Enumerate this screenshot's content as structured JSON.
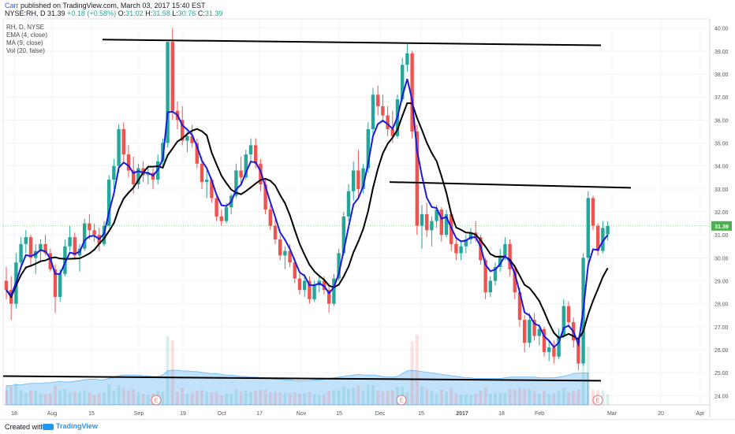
{
  "header": {
    "author": "Carr",
    "published_text": "published on TradingView.com, March 03, 2017 15:40 EST",
    "symbol": "NYSE:RH, D",
    "last": "31.39",
    "change": "+0.18 (+0.58%)",
    "open_label": "O:",
    "open": "31.02",
    "high_label": "H:",
    "high": "31.58",
    "low_label": "L:",
    "low": "30.76",
    "close_label": "C:",
    "close": "31.39"
  },
  "legend": {
    "lines": [
      "RH, D, NYSE",
      "EMA (4, close)",
      "MA (9, close)",
      "Vol (20, false)"
    ]
  },
  "footer": {
    "created_with": "Created with",
    "brand": "TradingView"
  },
  "colors": {
    "up": "#26a69a",
    "down": "#ef5350",
    "ema": "#1a1adb",
    "ma": "#000000",
    "volume_ma": "#90caf9",
    "price_badge": "#4caf50",
    "earnings": "#e57373"
  },
  "chart_data": {
    "type": "candlestick",
    "symbol": "RH, D, NYSE",
    "ylim": [
      23.6,
      40.4
    ],
    "y_ticks": [
      "24.00",
      "25.00",
      "26.00",
      "27.00",
      "28.00",
      "29.00",
      "30.00",
      "31.00",
      "32.00",
      "33.00",
      "34.00",
      "35.00",
      "36.00",
      "37.00",
      "38.00",
      "39.00",
      "40.00"
    ],
    "x_ticks": [
      "18",
      "Aug",
      "15",
      "Sep",
      "19",
      "Oct",
      "17",
      "Nov",
      "15",
      "Dec",
      "15",
      "2017",
      "18",
      "Feb",
      "Mar",
      "20",
      "Apr"
    ],
    "last_price_label": "31.39",
    "earnings_marker": "E",
    "trend_lines": [
      {
        "from": [
          "2016-08-31",
          39.5
        ],
        "to": [
          "2017-03-03",
          39.25
        ]
      },
      {
        "from": [
          "2016-12-05",
          33.3
        ],
        "to": [
          "2017-03-10",
          33.05
        ]
      },
      {
        "from": [
          "2016-07-15",
          24.85
        ],
        "to": [
          "2017-03-03",
          24.65
        ]
      }
    ],
    "candles": [
      {
        "o": 29.0,
        "h": 29.6,
        "l": 28.2,
        "c": 28.6
      },
      {
        "o": 28.6,
        "h": 29.2,
        "l": 27.3,
        "c": 28.0
      },
      {
        "o": 28.0,
        "h": 30.2,
        "l": 27.8,
        "c": 29.8
      },
      {
        "o": 29.8,
        "h": 30.9,
        "l": 29.5,
        "c": 30.6
      },
      {
        "o": 30.6,
        "h": 31.2,
        "l": 30.2,
        "c": 30.9
      },
      {
        "o": 30.9,
        "h": 31.0,
        "l": 29.6,
        "c": 30.0
      },
      {
        "o": 30.0,
        "h": 30.6,
        "l": 29.3,
        "c": 30.3
      },
      {
        "o": 30.3,
        "h": 30.8,
        "l": 29.8,
        "c": 30.6
      },
      {
        "o": 30.6,
        "h": 31.0,
        "l": 30.1,
        "c": 30.2
      },
      {
        "o": 30.2,
        "h": 30.4,
        "l": 29.4,
        "c": 29.5
      },
      {
        "o": 29.5,
        "h": 29.7,
        "l": 27.6,
        "c": 28.3
      },
      {
        "o": 28.3,
        "h": 29.5,
        "l": 28.1,
        "c": 29.3
      },
      {
        "o": 29.3,
        "h": 30.8,
        "l": 29.2,
        "c": 30.5
      },
      {
        "o": 30.5,
        "h": 31.4,
        "l": 30.3,
        "c": 30.9
      },
      {
        "o": 30.9,
        "h": 31.1,
        "l": 29.9,
        "c": 30.1
      },
      {
        "o": 30.1,
        "h": 30.6,
        "l": 29.4,
        "c": 30.4
      },
      {
        "o": 30.4,
        "h": 31.7,
        "l": 30.3,
        "c": 31.5
      },
      {
        "o": 31.5,
        "h": 31.9,
        "l": 30.8,
        "c": 31.2
      },
      {
        "o": 31.2,
        "h": 31.5,
        "l": 30.7,
        "c": 31.0
      },
      {
        "o": 31.0,
        "h": 31.3,
        "l": 30.3,
        "c": 30.6
      },
      {
        "o": 30.6,
        "h": 31.6,
        "l": 30.5,
        "c": 31.4
      },
      {
        "o": 31.4,
        "h": 33.6,
        "l": 31.3,
        "c": 33.4
      },
      {
        "o": 33.4,
        "h": 34.3,
        "l": 33.0,
        "c": 34.0
      },
      {
        "o": 34.0,
        "h": 35.8,
        "l": 33.7,
        "c": 35.6
      },
      {
        "o": 35.6,
        "h": 35.9,
        "l": 34.2,
        "c": 34.5
      },
      {
        "o": 34.5,
        "h": 34.9,
        "l": 33.5,
        "c": 33.8
      },
      {
        "o": 33.8,
        "h": 34.4,
        "l": 32.8,
        "c": 33.2
      },
      {
        "o": 33.2,
        "h": 34.1,
        "l": 33.0,
        "c": 33.9
      },
      {
        "o": 33.9,
        "h": 34.2,
        "l": 33.3,
        "c": 33.6
      },
      {
        "o": 33.6,
        "h": 34.0,
        "l": 33.2,
        "c": 33.7
      },
      {
        "o": 33.7,
        "h": 33.9,
        "l": 33.0,
        "c": 33.4
      },
      {
        "o": 33.4,
        "h": 34.5,
        "l": 33.2,
        "c": 34.2
      },
      {
        "o": 34.2,
        "h": 35.2,
        "l": 34.0,
        "c": 35.0
      },
      {
        "o": 35.0,
        "h": 39.4,
        "l": 34.8,
        "c": 39.4
      },
      {
        "o": 39.4,
        "h": 40.0,
        "l": 36.0,
        "c": 36.4
      },
      {
        "o": 36.4,
        "h": 36.8,
        "l": 35.6,
        "c": 36.0
      },
      {
        "o": 36.0,
        "h": 36.6,
        "l": 34.9,
        "c": 35.1
      },
      {
        "o": 35.1,
        "h": 35.5,
        "l": 34.6,
        "c": 35.3
      },
      {
        "o": 35.3,
        "h": 35.8,
        "l": 34.8,
        "c": 35.0
      },
      {
        "o": 35.0,
        "h": 35.2,
        "l": 33.9,
        "c": 34.1
      },
      {
        "o": 34.1,
        "h": 34.4,
        "l": 33.0,
        "c": 33.3
      },
      {
        "o": 33.3,
        "h": 33.8,
        "l": 32.6,
        "c": 33.4
      },
      {
        "o": 33.4,
        "h": 33.5,
        "l": 32.4,
        "c": 32.6
      },
      {
        "o": 32.6,
        "h": 32.8,
        "l": 31.6,
        "c": 31.8
      },
      {
        "o": 31.8,
        "h": 32.1,
        "l": 31.4,
        "c": 31.6
      },
      {
        "o": 31.6,
        "h": 32.4,
        "l": 31.5,
        "c": 32.2
      },
      {
        "o": 32.2,
        "h": 32.8,
        "l": 31.9,
        "c": 32.7
      },
      {
        "o": 32.7,
        "h": 34.1,
        "l": 32.6,
        "c": 33.8
      },
      {
        "o": 33.8,
        "h": 34.4,
        "l": 33.2,
        "c": 33.5
      },
      {
        "o": 33.5,
        "h": 34.7,
        "l": 33.4,
        "c": 34.5
      },
      {
        "o": 34.5,
        "h": 35.2,
        "l": 34.1,
        "c": 34.9
      },
      {
        "o": 34.9,
        "h": 35.2,
        "l": 33.9,
        "c": 34.1
      },
      {
        "o": 34.1,
        "h": 34.3,
        "l": 32.9,
        "c": 33.2
      },
      {
        "o": 33.2,
        "h": 33.4,
        "l": 31.9,
        "c": 32.1
      },
      {
        "o": 32.1,
        "h": 32.3,
        "l": 31.2,
        "c": 31.4
      },
      {
        "o": 31.4,
        "h": 31.7,
        "l": 30.6,
        "c": 30.8
      },
      {
        "o": 30.8,
        "h": 31.0,
        "l": 29.9,
        "c": 30.1
      },
      {
        "o": 30.1,
        "h": 30.5,
        "l": 29.5,
        "c": 30.3
      },
      {
        "o": 30.3,
        "h": 30.6,
        "l": 29.6,
        "c": 29.8
      },
      {
        "o": 29.8,
        "h": 30.0,
        "l": 28.9,
        "c": 29.1
      },
      {
        "o": 29.1,
        "h": 29.3,
        "l": 28.4,
        "c": 28.6
      },
      {
        "o": 28.6,
        "h": 29.3,
        "l": 28.3,
        "c": 29.0
      },
      {
        "o": 29.0,
        "h": 29.2,
        "l": 28.0,
        "c": 28.2
      },
      {
        "o": 28.2,
        "h": 29.0,
        "l": 28.1,
        "c": 28.8
      },
      {
        "o": 28.8,
        "h": 29.2,
        "l": 28.5,
        "c": 29.0
      },
      {
        "o": 29.0,
        "h": 29.2,
        "l": 28.4,
        "c": 28.6
      },
      {
        "o": 28.6,
        "h": 28.9,
        "l": 27.6,
        "c": 28.0
      },
      {
        "o": 28.0,
        "h": 29.3,
        "l": 27.9,
        "c": 29.1
      },
      {
        "o": 29.1,
        "h": 30.4,
        "l": 29.0,
        "c": 30.2
      },
      {
        "o": 30.2,
        "h": 32.0,
        "l": 30.1,
        "c": 31.8
      },
      {
        "o": 31.8,
        "h": 33.2,
        "l": 31.6,
        "c": 32.9
      },
      {
        "o": 32.9,
        "h": 34.2,
        "l": 32.5,
        "c": 33.8
      },
      {
        "o": 33.8,
        "h": 34.7,
        "l": 32.6,
        "c": 33.0
      },
      {
        "o": 33.0,
        "h": 34.1,
        "l": 32.8,
        "c": 33.9
      },
      {
        "o": 33.9,
        "h": 35.9,
        "l": 33.7,
        "c": 35.6
      },
      {
        "o": 35.6,
        "h": 37.4,
        "l": 35.3,
        "c": 37.1
      },
      {
        "o": 37.1,
        "h": 37.5,
        "l": 36.2,
        "c": 36.6
      },
      {
        "o": 36.6,
        "h": 37.1,
        "l": 35.9,
        "c": 36.2
      },
      {
        "o": 36.2,
        "h": 36.6,
        "l": 35.3,
        "c": 35.6
      },
      {
        "o": 35.6,
        "h": 36.4,
        "l": 35.0,
        "c": 35.3
      },
      {
        "o": 35.3,
        "h": 37.1,
        "l": 35.2,
        "c": 36.9
      },
      {
        "o": 36.9,
        "h": 38.7,
        "l": 36.8,
        "c": 38.4
      },
      {
        "o": 38.4,
        "h": 39.3,
        "l": 38.1,
        "c": 38.9
      },
      {
        "o": 38.9,
        "h": 39.0,
        "l": 35.2,
        "c": 35.5
      },
      {
        "o": 35.5,
        "h": 35.8,
        "l": 31.0,
        "c": 31.4
      },
      {
        "o": 31.4,
        "h": 32.3,
        "l": 30.4,
        "c": 31.9
      },
      {
        "o": 31.9,
        "h": 32.4,
        "l": 30.9,
        "c": 31.2
      },
      {
        "o": 31.2,
        "h": 31.8,
        "l": 30.5,
        "c": 31.6
      },
      {
        "o": 31.6,
        "h": 32.3,
        "l": 31.3,
        "c": 32.1
      },
      {
        "o": 32.1,
        "h": 32.2,
        "l": 30.7,
        "c": 31.0
      },
      {
        "o": 31.0,
        "h": 32.1,
        "l": 30.9,
        "c": 31.9
      },
      {
        "o": 31.9,
        "h": 32.0,
        "l": 30.3,
        "c": 30.6
      },
      {
        "o": 30.6,
        "h": 30.9,
        "l": 29.9,
        "c": 30.2
      },
      {
        "o": 30.2,
        "h": 30.7,
        "l": 29.9,
        "c": 30.5
      },
      {
        "o": 30.5,
        "h": 31.0,
        "l": 30.2,
        "c": 30.8
      },
      {
        "o": 30.8,
        "h": 31.3,
        "l": 30.6,
        "c": 31.1
      },
      {
        "o": 31.1,
        "h": 31.6,
        "l": 30.7,
        "c": 30.9
      },
      {
        "o": 30.9,
        "h": 31.0,
        "l": 29.7,
        "c": 29.9
      },
      {
        "o": 29.9,
        "h": 30.0,
        "l": 28.2,
        "c": 28.5
      },
      {
        "o": 28.5,
        "h": 29.2,
        "l": 28.3,
        "c": 29.0
      },
      {
        "o": 29.0,
        "h": 29.8,
        "l": 28.8,
        "c": 29.6
      },
      {
        "o": 29.6,
        "h": 30.4,
        "l": 29.4,
        "c": 30.1
      },
      {
        "o": 30.1,
        "h": 30.9,
        "l": 29.9,
        "c": 30.6
      },
      {
        "o": 30.6,
        "h": 30.8,
        "l": 29.2,
        "c": 29.5
      },
      {
        "o": 29.5,
        "h": 29.7,
        "l": 28.2,
        "c": 28.5
      },
      {
        "o": 28.5,
        "h": 28.7,
        "l": 27.0,
        "c": 27.3
      },
      {
        "o": 27.3,
        "h": 27.5,
        "l": 25.9,
        "c": 26.3
      },
      {
        "o": 26.3,
        "h": 27.6,
        "l": 26.1,
        "c": 27.3
      },
      {
        "o": 27.3,
        "h": 27.6,
        "l": 26.4,
        "c": 26.6
      },
      {
        "o": 26.6,
        "h": 27.1,
        "l": 26.2,
        "c": 26.9
      },
      {
        "o": 26.9,
        "h": 27.0,
        "l": 25.7,
        "c": 25.9
      },
      {
        "o": 25.9,
        "h": 26.4,
        "l": 25.5,
        "c": 26.1
      },
      {
        "o": 26.1,
        "h": 26.4,
        "l": 25.4,
        "c": 25.7
      },
      {
        "o": 25.7,
        "h": 26.9,
        "l": 25.6,
        "c": 26.6
      },
      {
        "o": 26.6,
        "h": 28.2,
        "l": 26.5,
        "c": 27.9
      },
      {
        "o": 27.9,
        "h": 28.1,
        "l": 27.0,
        "c": 27.2
      },
      {
        "o": 27.2,
        "h": 27.4,
        "l": 26.1,
        "c": 26.4
      },
      {
        "o": 26.4,
        "h": 26.6,
        "l": 25.1,
        "c": 25.4
      },
      {
        "o": 25.4,
        "h": 30.2,
        "l": 25.3,
        "c": 30.0
      },
      {
        "o": 30.0,
        "h": 32.9,
        "l": 29.8,
        "c": 32.6
      },
      {
        "o": 32.6,
        "h": 32.7,
        "l": 31.2,
        "c": 31.4
      },
      {
        "o": 31.4,
        "h": 31.5,
        "l": 30.1,
        "c": 30.3
      },
      {
        "o": 30.3,
        "h": 31.6,
        "l": 30.2,
        "c": 31.3
      },
      {
        "o": 31.02,
        "h": 31.58,
        "l": 30.76,
        "c": 31.39
      }
    ],
    "volume_ma": [
      0.55,
      0.56,
      0.58,
      0.58,
      0.6,
      0.62,
      0.62,
      0.62,
      0.64,
      0.64,
      0.66,
      0.68,
      0.66,
      0.66,
      0.68,
      0.7,
      0.72,
      0.74,
      0.74,
      0.72,
      0.72,
      0.76,
      0.8,
      0.84,
      0.86,
      0.86,
      0.86,
      0.86,
      0.84,
      0.84,
      0.82,
      0.82,
      0.86,
      0.98,
      1.0,
      1.0,
      0.98,
      0.98,
      0.96,
      0.96,
      0.94,
      0.92,
      0.9,
      0.9,
      0.88,
      0.86,
      0.86,
      0.84,
      0.82,
      0.82,
      0.8,
      0.8,
      0.78,
      0.78,
      0.76,
      0.74,
      0.74,
      0.72,
      0.72,
      0.7,
      0.7,
      0.7,
      0.7,
      0.72,
      0.72,
      0.74,
      0.76,
      0.78,
      0.8,
      0.82,
      0.84,
      0.86,
      0.88,
      0.86,
      0.86,
      0.86,
      0.84,
      0.82,
      0.8,
      0.8,
      0.82,
      0.9,
      0.98,
      1.0,
      0.98,
      0.96,
      0.94,
      0.92,
      0.9,
      0.88,
      0.86,
      0.84,
      0.82,
      0.8,
      0.78,
      0.78,
      0.76,
      0.76,
      0.76,
      0.76,
      0.76,
      0.76,
      0.78,
      0.8,
      0.8,
      0.8,
      0.8,
      0.8,
      0.8,
      0.78,
      0.78,
      0.78,
      0.78,
      0.8,
      0.82,
      0.86,
      0.9,
      0.92,
      0.92,
      0.92
    ]
  }
}
